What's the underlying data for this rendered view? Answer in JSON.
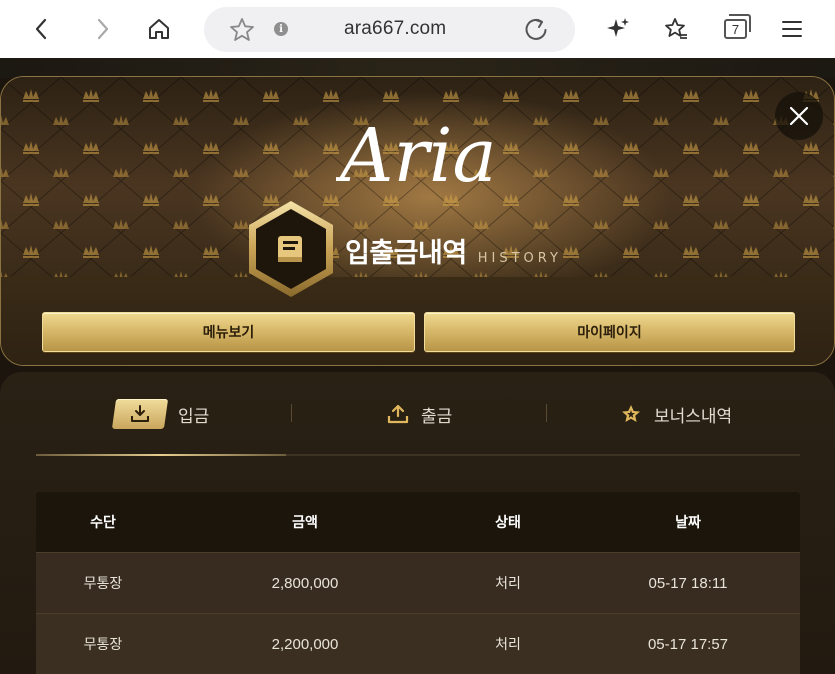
{
  "browser": {
    "url": "ara667.com",
    "tab_count": "7",
    "icons": [
      "back-arrow-icon",
      "forward-arrow-icon",
      "home-icon",
      "bookmark-star-icon",
      "site-info-icon",
      "reload-icon",
      "sparkle-ai-icon",
      "favorites-icon",
      "tabs-icon",
      "menu-icon"
    ]
  },
  "modal": {
    "logo_text": "Aria",
    "title": "입출금내역",
    "title_en": "HISTORY",
    "buttons": {
      "menu": "메뉴보기",
      "mypage": "마이페이지"
    }
  },
  "tabs": [
    {
      "label": "입금",
      "icon": "download-icon",
      "active": true
    },
    {
      "label": "출금",
      "icon": "upload-icon",
      "active": false
    },
    {
      "label": "보너스내역",
      "icon": "star-icon",
      "active": false
    }
  ],
  "table": {
    "headers": [
      "수단",
      "금액",
      "상태",
      "날짜"
    ],
    "rows": [
      [
        "무통장",
        "2,800,000",
        "처리",
        "05-17 18:11"
      ],
      [
        "무통장",
        "2,200,000",
        "처리",
        "05-17 17:57"
      ]
    ]
  },
  "colors": {
    "gold": "#d8b96a",
    "background": "#2a1f10",
    "text": "#ffffff"
  }
}
